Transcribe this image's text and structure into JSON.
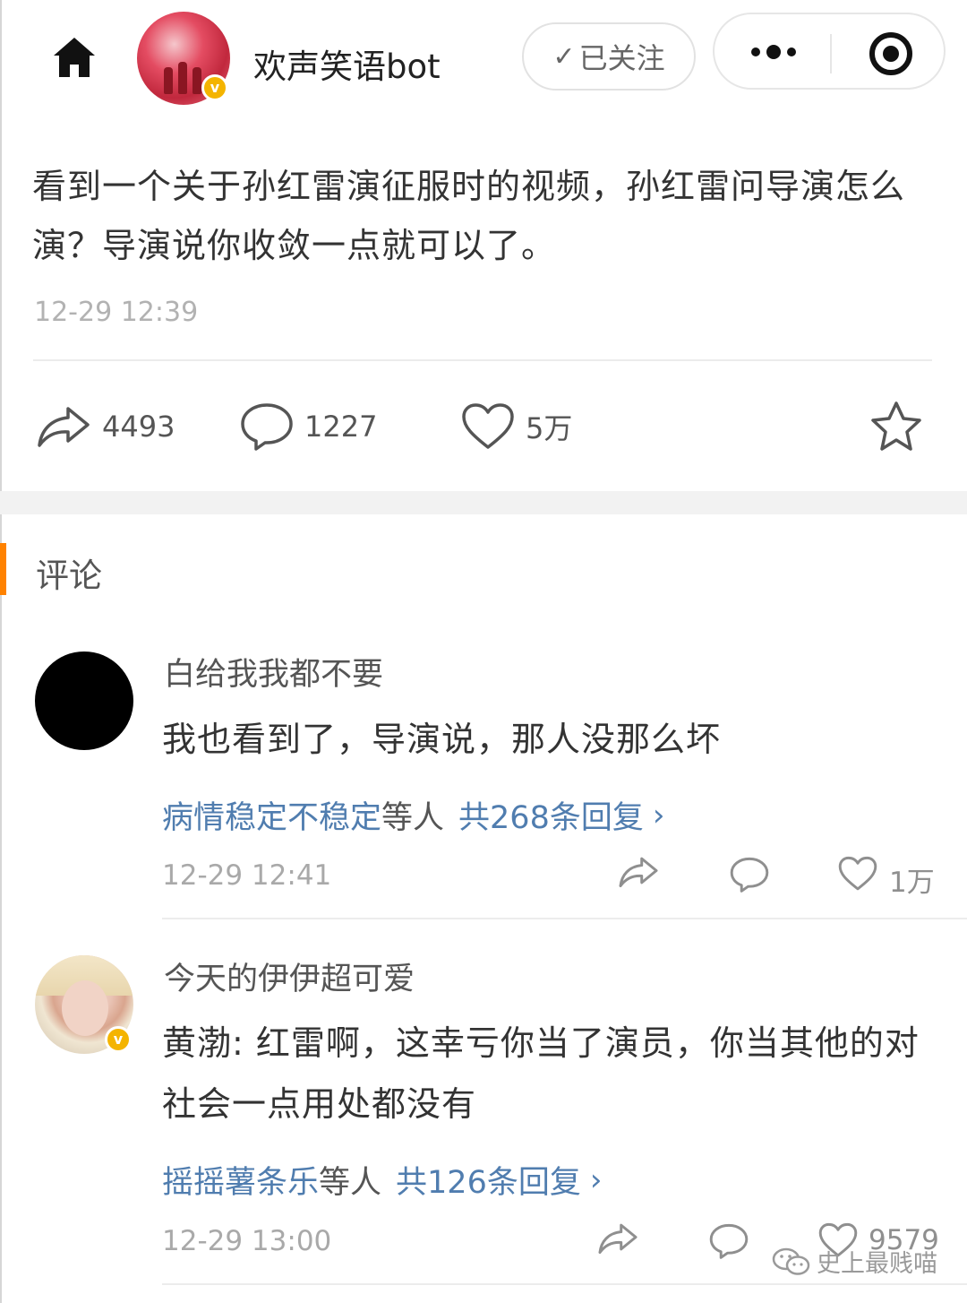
{
  "header": {
    "username": "欢声笑语bot",
    "follow_label": "已关注",
    "verified_badge": "v"
  },
  "post": {
    "text": "看到一个关于孙红雷演征服时的视频，孙红雷问导演怎么演？导演说你收敛一点就可以了。",
    "time": "12-29 12:39",
    "reposts": "4493",
    "comments": "1227",
    "likes": "5万"
  },
  "comments_section": {
    "title": "评论",
    "accent_color": "#ff8200",
    "items": [
      {
        "user": "白给我我都不要",
        "text": "我也看到了，导演说，那人没那么坏",
        "reply_users": "病情稳定不稳定",
        "reply_mid": "等人",
        "reply_count": "共268条回复",
        "time": "12-29 12:41",
        "likes": "1万"
      },
      {
        "user": "今天的伊伊超可爱",
        "text": "黄渤: 红雷啊，这幸亏你当了演员，你当其他的对社会一点用处都没有",
        "reply_users": "摇摇薯条乐",
        "reply_mid": "等人",
        "reply_count": "共126条回复",
        "time": "12-29 13:00",
        "likes": "9579"
      }
    ]
  },
  "watermark": "史上最贱喵",
  "colors": {
    "link": "#507daf",
    "badge": "#f4b400"
  }
}
